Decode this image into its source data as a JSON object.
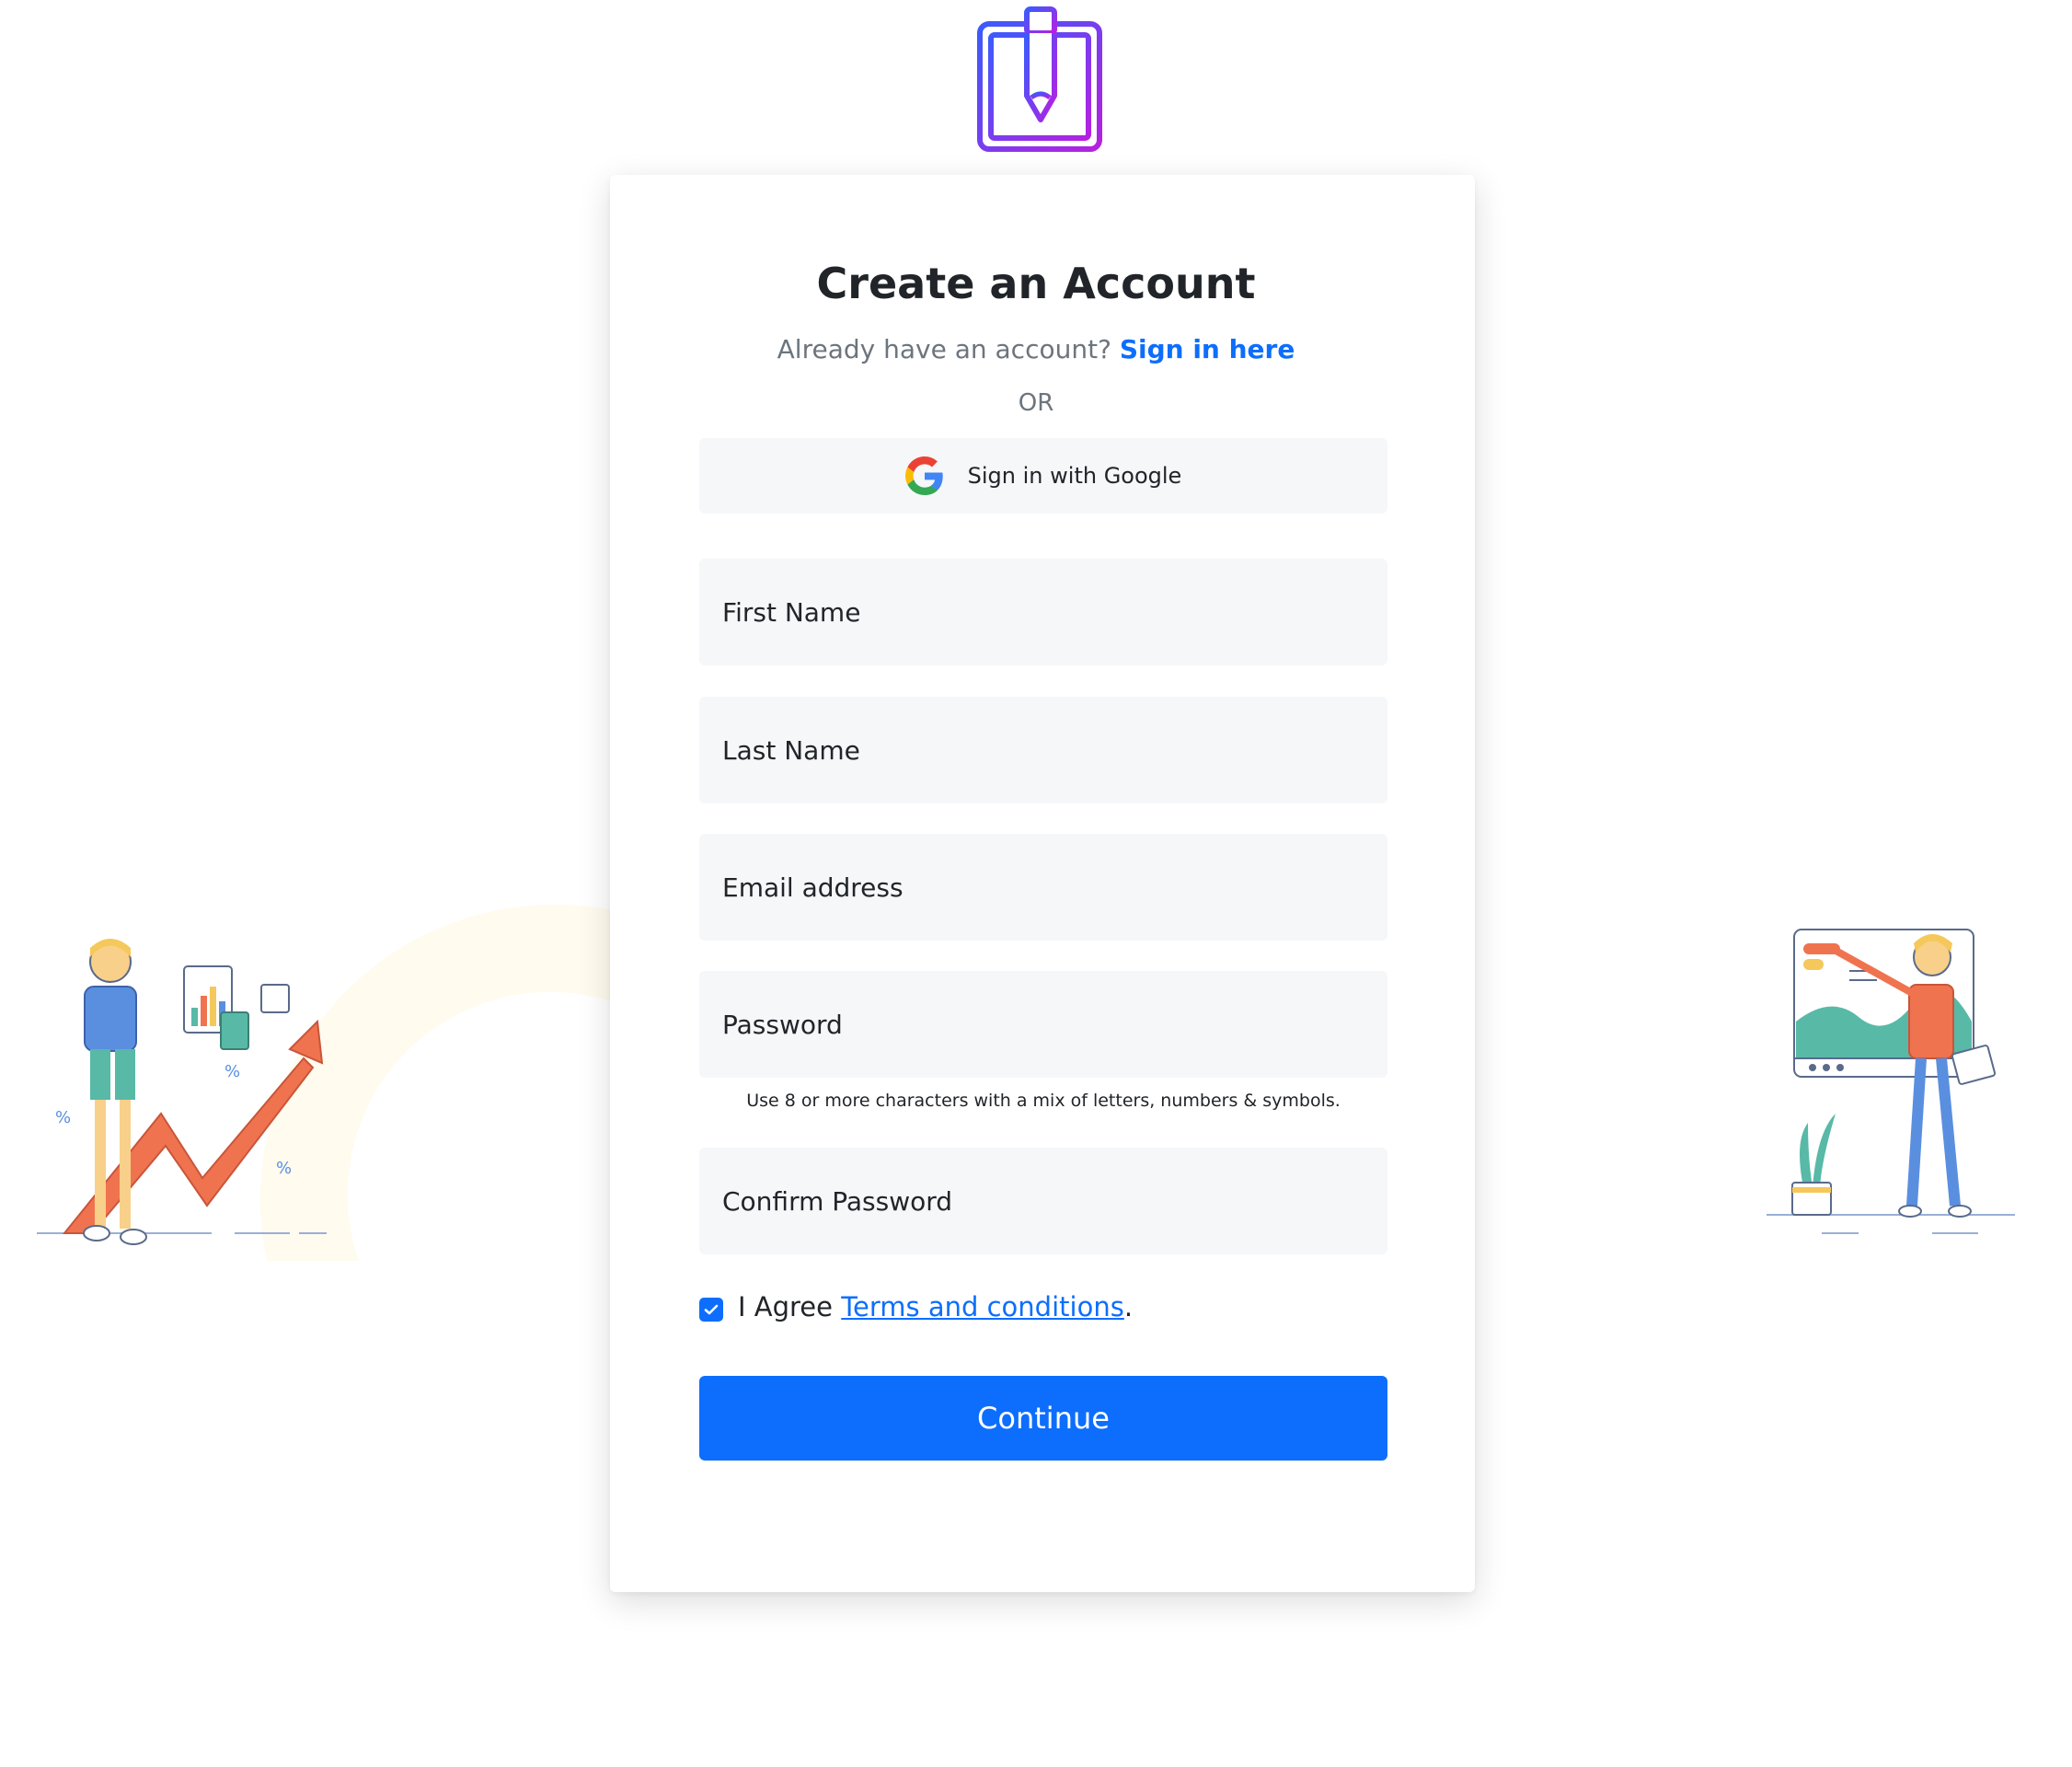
{
  "header": {
    "logo_icon": "clipboard-pencil-icon"
  },
  "form": {
    "title": "Create an Account",
    "signin_prompt": "Already have an account?",
    "signin_link": "Sign in here",
    "or_text": "OR",
    "google_button": "Sign in with Google",
    "fields": {
      "first_name": "First Name",
      "last_name": "Last Name",
      "email": "Email address",
      "password": "Password",
      "confirm_password": "Confirm Password"
    },
    "password_hint": "Use 8 or more characters with a mix of letters, numbers & symbols.",
    "agree_prefix": "I Agree",
    "terms_link": "Terms and conditions",
    "agree_suffix": ".",
    "agree_checked": true,
    "continue_button": "Continue"
  },
  "colors": {
    "primary": "#0d6efd",
    "logo_gradient_start": "#3b5bfd",
    "logo_gradient_end": "#b620e0",
    "field_bg": "#f5f7f9"
  }
}
